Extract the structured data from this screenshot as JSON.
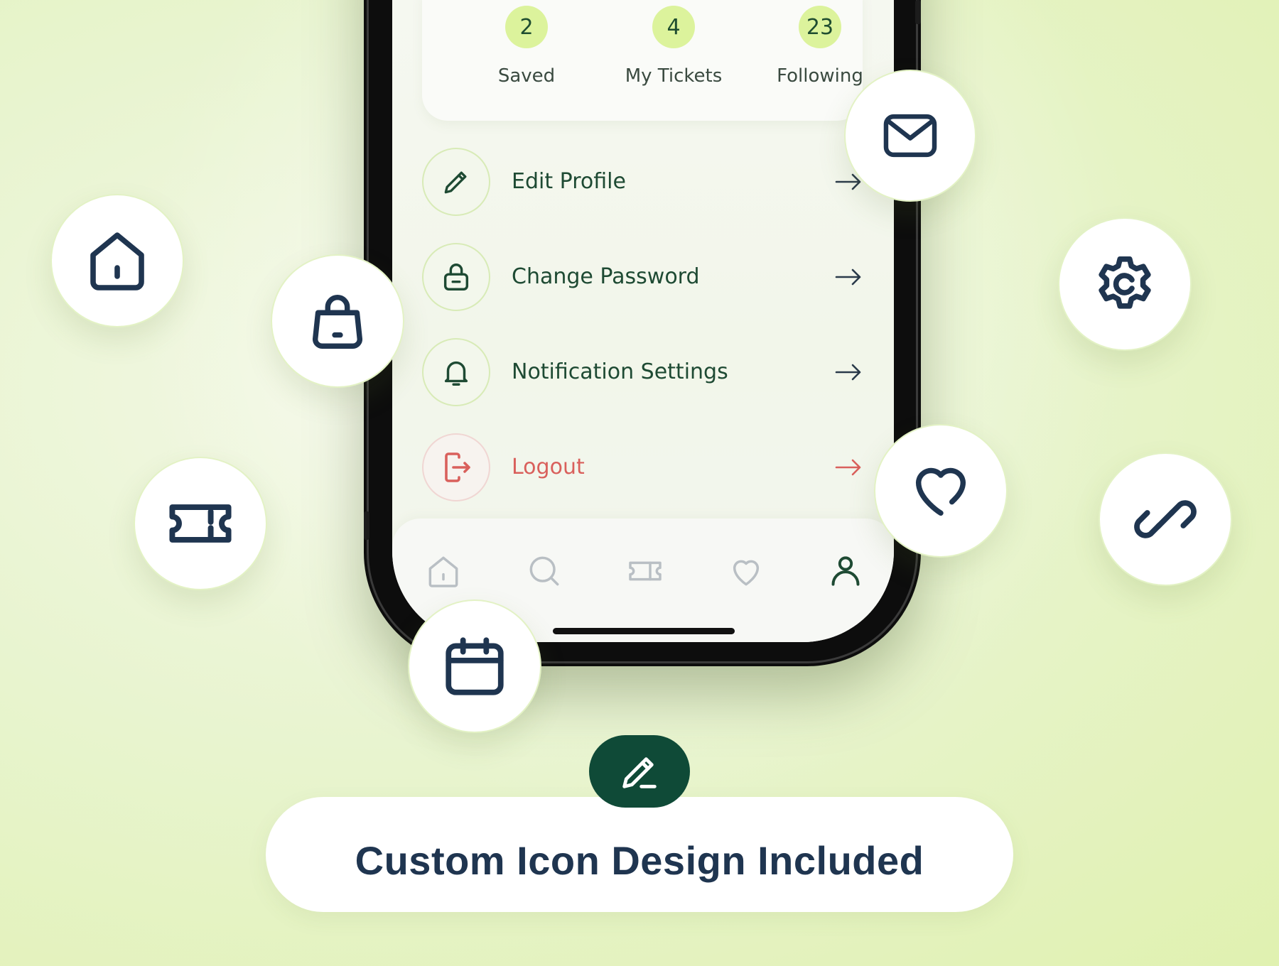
{
  "stats": [
    {
      "value": "2",
      "label": "Saved"
    },
    {
      "value": "4",
      "label": "My Tickets"
    },
    {
      "value": "23",
      "label": "Following"
    }
  ],
  "menu": [
    {
      "label": "Edit Profile",
      "icon": "pencil-icon"
    },
    {
      "label": "Change Password",
      "icon": "lock-icon"
    },
    {
      "label": "Notification Settings",
      "icon": "bell-icon"
    },
    {
      "label": "Logout",
      "icon": "logout-icon"
    }
  ],
  "tabs": [
    "home-icon",
    "search-icon",
    "ticket-icon",
    "heart-icon",
    "user-icon"
  ],
  "floating_icons": [
    "mail-icon",
    "home-icon",
    "shopping-bag-icon",
    "gear-icon",
    "ticket-icon",
    "heart-icon",
    "link-icon",
    "calendar-icon"
  ],
  "banner": {
    "text": "Custom Icon Design Included",
    "badge_icon": "edit-icon"
  },
  "colors": {
    "primary_dark_green": "#0f4a37",
    "text_green": "#1e4a33",
    "accent_lime": "#dcf39c",
    "danger": "#d9605c",
    "icon_navy": "#1f3550"
  }
}
